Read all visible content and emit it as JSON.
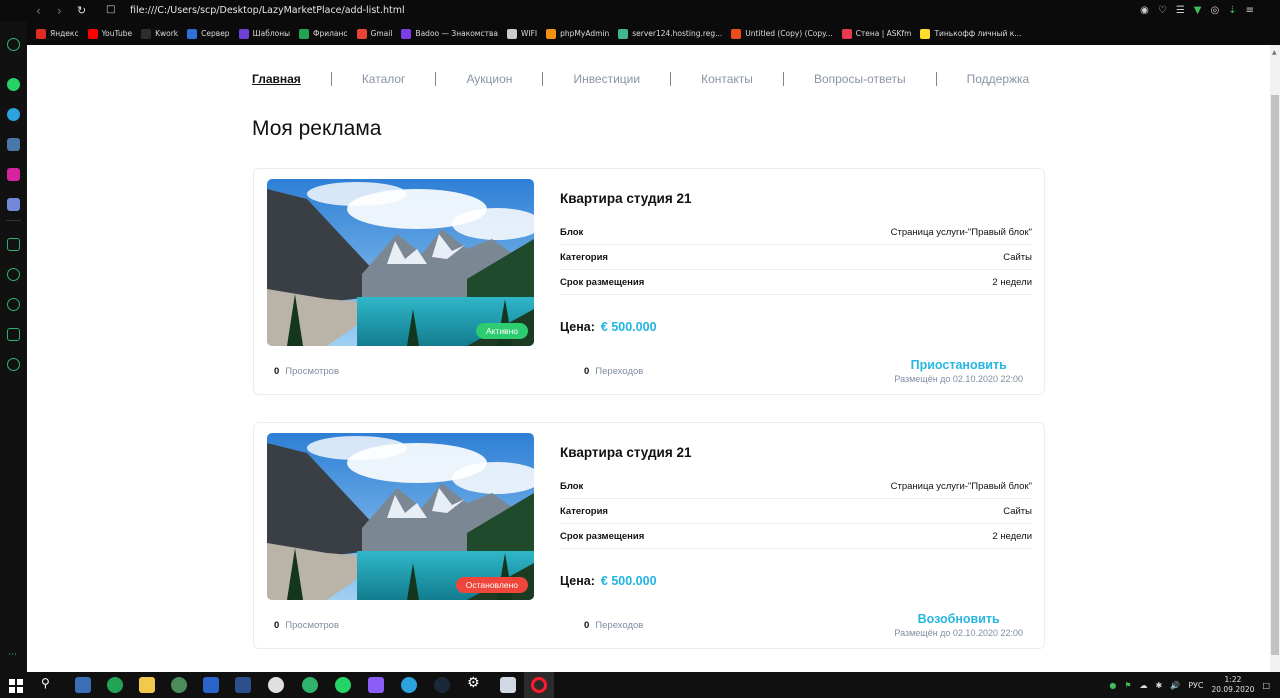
{
  "browser": {
    "url": "file:///C:/Users/scp/Desktop/LazyMarketPlace/add-list.html",
    "bookmarks": [
      {
        "label": "Яндекс",
        "color": "#e02b20"
      },
      {
        "label": "YouTube",
        "color": "#ff0000"
      },
      {
        "label": "Kwork",
        "color": "#2d2d2d"
      },
      {
        "label": "Сервер",
        "color": "#2f6fd6"
      },
      {
        "label": "Шаблоны",
        "color": "#6f3fd6"
      },
      {
        "label": "Фриланс",
        "color": "#23a455"
      },
      {
        "label": "Gmail",
        "color": "#ea4335"
      },
      {
        "label": "Badoo — Знакомства",
        "color": "#7b3fe4"
      },
      {
        "label": "WIFI",
        "color": "#cccccc"
      },
      {
        "label": "phpMyAdmin",
        "color": "#f29111"
      },
      {
        "label": "server124.hosting.reg...",
        "color": "#3fb98b"
      },
      {
        "label": "Untitled (Copy) (Copy...",
        "color": "#e94e1b"
      },
      {
        "label": "Стена | ASKfm",
        "color": "#e83a4f"
      },
      {
        "label": "Тинькофф личный к...",
        "color": "#ffdd2d"
      }
    ]
  },
  "nav": {
    "items": [
      {
        "label": "Главная",
        "active": true
      },
      {
        "label": "Каталог",
        "active": false
      },
      {
        "label": "Аукцион",
        "active": false
      },
      {
        "label": "Инвестиции",
        "active": false
      },
      {
        "label": "Контакты",
        "active": false
      },
      {
        "label": "Вопросы-ответы",
        "active": false
      },
      {
        "label": "Поддержка",
        "active": false
      }
    ]
  },
  "page_title": "Моя реклама",
  "ads": [
    {
      "title": "Квартира студия 21",
      "status": "Активно",
      "status_color": "#2ecc71",
      "specs": [
        {
          "key": "Блок",
          "value": "Страница услуги-\"Правый блок\""
        },
        {
          "key": "Категория",
          "value": "Сайты"
        },
        {
          "key": "Срок размещения",
          "value": "2 недели"
        }
      ],
      "price_label": "Цена:",
      "price_value": "€ 500.000",
      "views_count": "0",
      "views_label": "Просмотров",
      "clicks_count": "0",
      "clicks_label": "Переходов",
      "action_label": "Приостановить",
      "placed_until": "Размещён до 02.10.2020 22:00"
    },
    {
      "title": "Квартира студия 21",
      "status": "Остановлено",
      "status_color": "#f0453a",
      "specs": [
        {
          "key": "Блок",
          "value": "Страница услуги-\"Правый блок\""
        },
        {
          "key": "Категория",
          "value": "Сайты"
        },
        {
          "key": "Срок размещения",
          "value": "2 недели"
        }
      ],
      "price_label": "Цена:",
      "price_value": "€ 500.000",
      "views_count": "0",
      "views_label": "Просмотров",
      "clicks_count": "0",
      "clicks_label": "Переходов",
      "action_label": "Возобновить",
      "placed_until": "Размещён до 02.10.2020 22:00"
    }
  ],
  "taskbar": {
    "lang": "РУС",
    "time": "1:22",
    "date": "20.09.2020"
  },
  "colors": {
    "accent": "#1fb5e2",
    "active_status": "#2ecc71",
    "stopped_status": "#f0453a",
    "muted_text": "#7f8ea3"
  }
}
